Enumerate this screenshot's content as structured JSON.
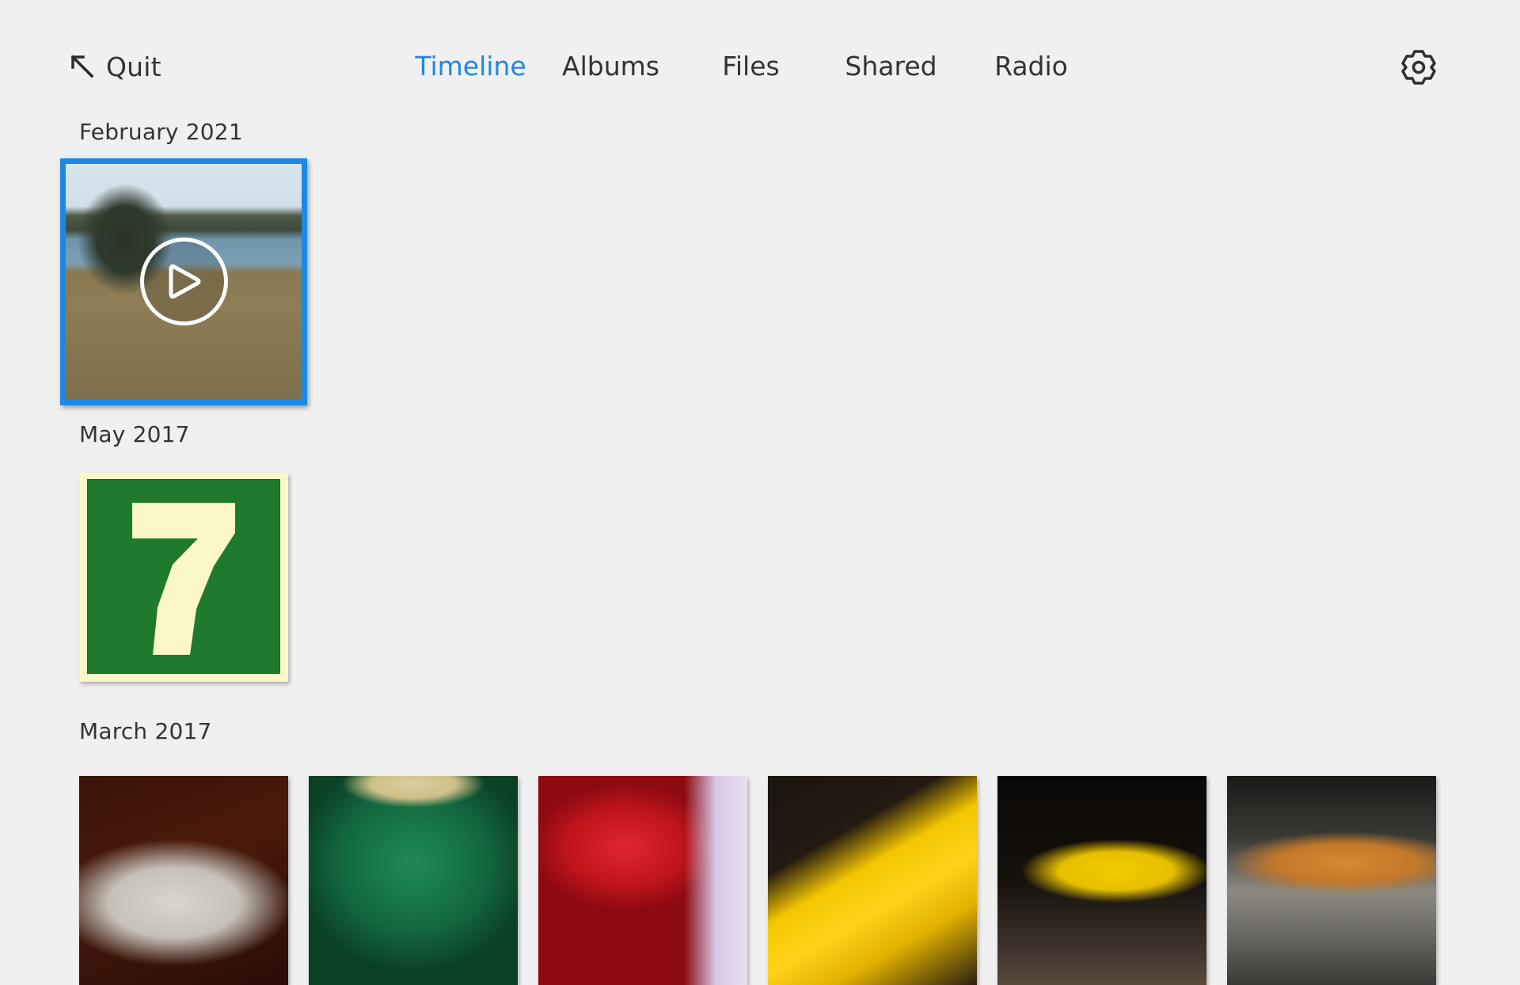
{
  "header": {
    "quit": {
      "icon": "arrow-up-left-icon",
      "label": "Quit"
    },
    "tabs": [
      {
        "label": "Timeline",
        "active": true
      },
      {
        "label": "Albums",
        "active": false
      },
      {
        "label": "Files",
        "active": false
      },
      {
        "label": "Shared",
        "active": false
      },
      {
        "label": "Radio",
        "active": false
      }
    ],
    "settings": {
      "icon": "gear-icon"
    }
  },
  "colors": {
    "background": "#f0f0f0",
    "text": "#333333",
    "accent": "#1e88e5"
  },
  "timeline": {
    "sections": [
      {
        "title": "February 2021",
        "items": [
          {
            "kind": "video",
            "focused": true,
            "thumbnail": "lake-landscape",
            "overlay_icon": "play-circle-icon"
          }
        ]
      },
      {
        "title": "May 2017",
        "items": [
          {
            "kind": "photo",
            "focused": false,
            "thumbnail": "green-sign-number-7",
            "sign_text": "7"
          }
        ]
      },
      {
        "title": "March 2017",
        "items": [
          {
            "kind": "photo",
            "thumbnail": "white-convertible-car"
          },
          {
            "kind": "photo",
            "thumbnail": "green-sports-car"
          },
          {
            "kind": "photo",
            "thumbnail": "red-car-rear"
          },
          {
            "kind": "photo",
            "thumbnail": "yellow-sports-car"
          },
          {
            "kind": "photo",
            "thumbnail": "yellow-car-at-show"
          },
          {
            "kind": "photo",
            "thumbnail": "orange-car-at-show"
          }
        ]
      }
    ]
  }
}
